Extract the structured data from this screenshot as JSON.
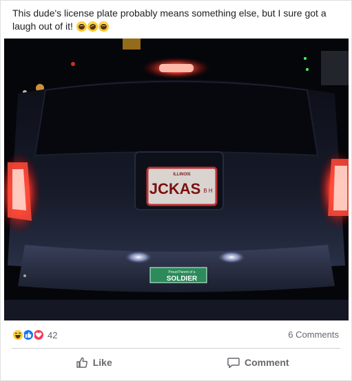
{
  "post": {
    "caption": "This dude's license plate probably means something else, but I sure got a laugh out of it!",
    "caption_emojis": [
      "laughing-emoji",
      "rolling-laughing-emoji",
      "laughing-emoji"
    ]
  },
  "photo": {
    "plate_state": "ILLINOIS",
    "plate_text": "JCKAS",
    "plate_side": "B H",
    "frame_text": "SOLDIER",
    "frame_subtext": "Proud Parent of a"
  },
  "reactions": {
    "types": [
      "haha",
      "like",
      "love"
    ],
    "count": "42",
    "colors": {
      "like": "#1877f2",
      "love": "#f33e58",
      "haha": "#f7c31f"
    }
  },
  "comments": {
    "label": "6 Comments"
  },
  "actions": {
    "like_label": "Like",
    "comment_label": "Comment"
  }
}
